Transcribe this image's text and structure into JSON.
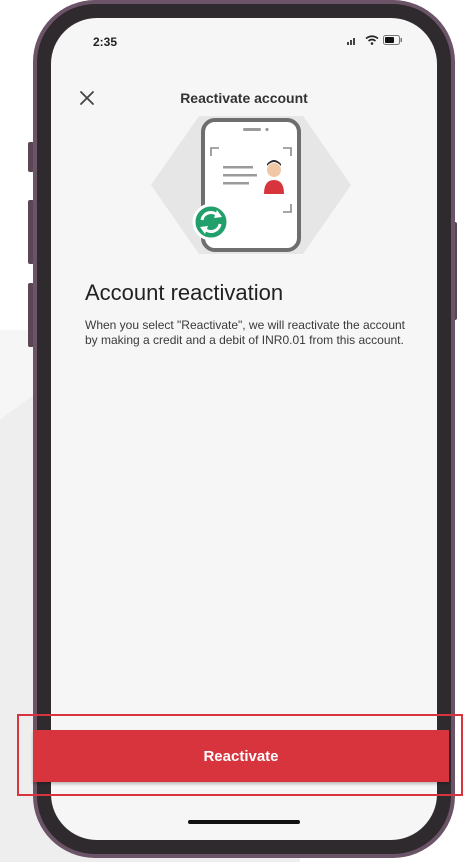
{
  "status_bar": {
    "time": "2:35"
  },
  "nav": {
    "title": "Reactivate account",
    "close_icon": "close-icon"
  },
  "content": {
    "title": "Account reactivation",
    "body": "When you select \"Reactivate\", we will reactivate the account by making a credit and a debit of INR0.01 from this account."
  },
  "cta": {
    "label": "Reactivate"
  },
  "colors": {
    "primary": "#d7343d",
    "success": "#22a06b",
    "phone_frame": "#6b5467",
    "screen_bg": "#f6f6f6"
  },
  "icons": {
    "illustration": "phone-id-card-reactivation-illustration",
    "sync": "sync-icon",
    "wifi": "wifi-icon",
    "battery": "battery-icon",
    "signal": "signal-icon"
  }
}
